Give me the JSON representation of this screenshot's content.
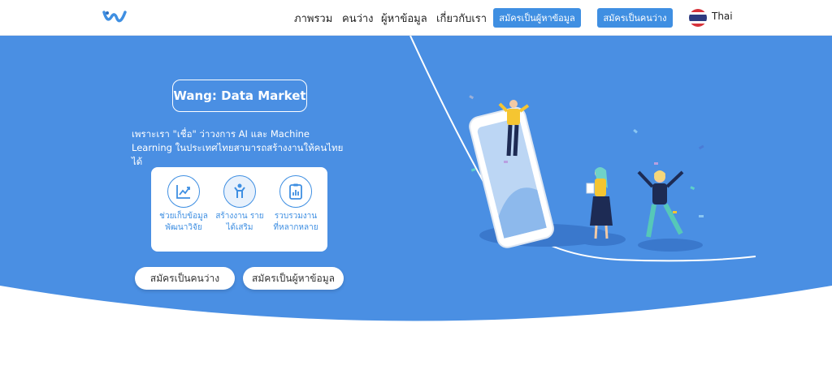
{
  "nav": {
    "links": [
      "ภาพรวม",
      "คนว่าง",
      "ผู้หาข้อมูล",
      "เกี่ยวกับเรา"
    ],
    "button_data_seeker": "สมัครเป็นผู้หาข้อมูล",
    "button_worker": "สมัครเป็นคนว่าง",
    "language": "Thai"
  },
  "hero": {
    "title": "Wang: Data Market",
    "tagline": "เพราะเรา \"เชื่อ\" ว่าวงการ AI และ Machine Learning ในประเทศไทยสามารถสร้างงานให้คนไทยได้",
    "features": [
      {
        "line1": "ช่วยเก็บข้อมูล",
        "line2": "พัฒนาวิจัย",
        "icon": "chart-icon"
      },
      {
        "line1": "สร้างงาน ราย",
        "line2": "ได้เสริม",
        "icon": "person-icon"
      },
      {
        "line1": "รวบรวมงาน",
        "line2": "ที่หลากหลาย",
        "icon": "clipboard-icon"
      }
    ],
    "cta_worker": "สมัครเป็นคนว่าง",
    "cta_data_seeker": "สมัครเป็นผู้หาข้อมูล"
  },
  "colors": {
    "primary": "#4a8fe3",
    "button": "#3f8fe2",
    "text_dark": "#222222",
    "white": "#ffffff"
  }
}
